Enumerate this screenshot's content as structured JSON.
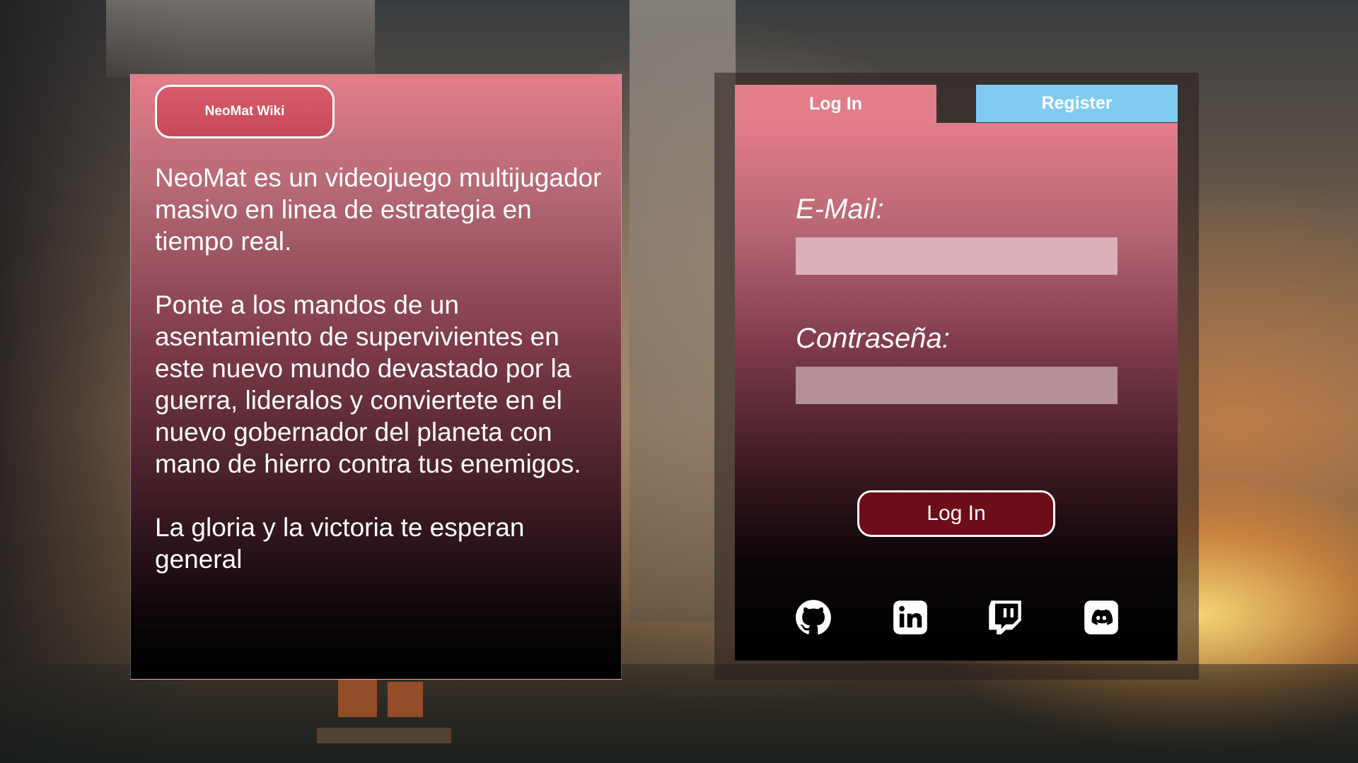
{
  "wiki_button": {
    "label": "NeoMat Wiki"
  },
  "info": {
    "paragraphs": [
      "NeoMat es un videojuego multijugador masivo en linea de estrategia en tiempo real.",
      "Ponte a los mandos de un asentamiento de supervivientes en este nuevo mundo devastado por la guerra, lideralos y conviertete en el nuevo gobernador del planeta con mano de hierro contra tus enemigos.",
      "La gloria y la victoria te esperan general"
    ]
  },
  "login": {
    "tabs": {
      "login": "Log In",
      "register": "Register"
    },
    "email_label": "E-Mail:",
    "email_value": "",
    "password_label": "Contraseña:",
    "password_value": "",
    "submit_label": "Log In",
    "social_icons": [
      "github-icon",
      "linkedin-icon",
      "twitch-icon",
      "discord-icon"
    ]
  },
  "colors": {
    "panel_pink": "#e47d8a",
    "register_tab": "#80ccf0",
    "login_button": "#6e0d1a",
    "wiki_button": "#d85b6b"
  }
}
